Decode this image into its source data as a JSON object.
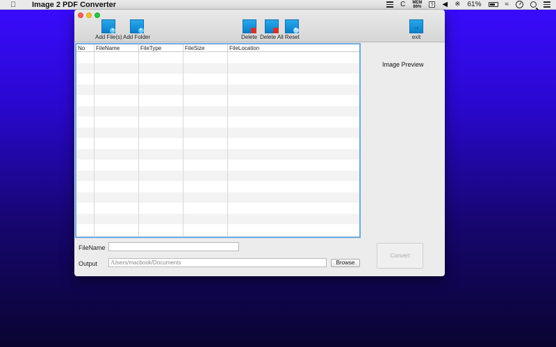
{
  "menubar": {
    "apple_icon": "apple-logo",
    "app_name": "Image 2 PDF Converter",
    "c_label": "C",
    "mem_label": "MEM",
    "mem_value": "86%",
    "battery": "61%",
    "mini_box": "5"
  },
  "toolbar": {
    "add_files": "Add File(s)",
    "add_folder": "Add Folder",
    "delete": "Delete",
    "delete_all": "Delete All",
    "reset": "Reset",
    "exit": "exit"
  },
  "table": {
    "columns": [
      "No",
      "FileName",
      "FileType",
      "FileSize",
      "FileLocation"
    ],
    "rows": []
  },
  "preview": {
    "label": "Image Preview"
  },
  "form": {
    "filename_label": "FileName",
    "filename_value": "",
    "output_label": "Output",
    "output_value": "/Users/macbook/Documents",
    "browse_label": "Browse",
    "convert_label": "Convert"
  },
  "colors": {
    "desktop_top": "#3a0cff",
    "toolbar_icon": "#1a92dc",
    "table_focus_border": "#6ca8de"
  }
}
